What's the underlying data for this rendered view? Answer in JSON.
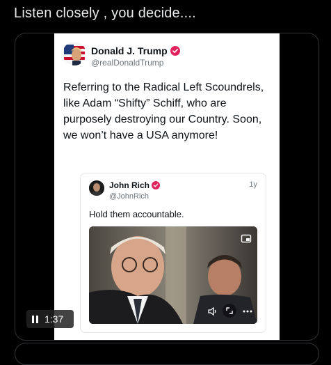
{
  "post": {
    "text": "Listen closely , you decide...."
  },
  "embedded_tweet": {
    "author_name": "Donald J. Trump",
    "author_handle": "@realDonaldTrump",
    "body": "Referring to the Radical Left Scoundrels, like Adam “Shifty” Schiff, who are purposely destroying our Country. Soon, we won’t have a USA anymore!",
    "verified_color": "#e0245e",
    "quote": {
      "author_name": "John Rich",
      "author_handle": "@JohnRich",
      "time": "1y",
      "body": "Hold them accountable.",
      "controls": [
        "picture-in-picture-icon",
        "volume-icon",
        "expand-icon",
        "more-icon"
      ]
    }
  },
  "video": {
    "time": "1:37",
    "state": "paused"
  }
}
